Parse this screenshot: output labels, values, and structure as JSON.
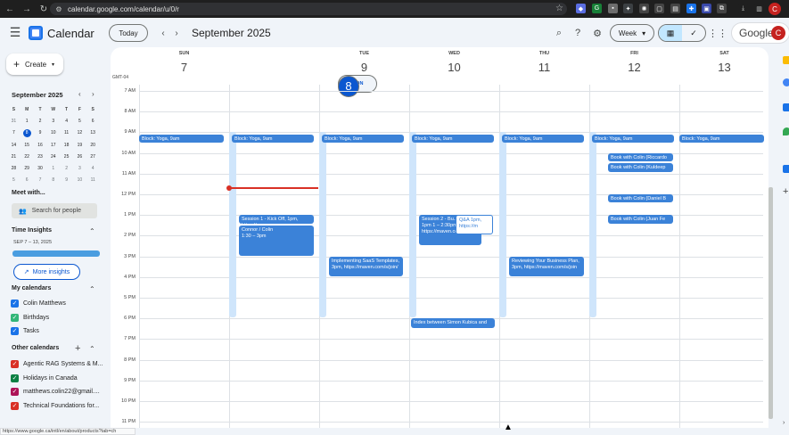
{
  "browser": {
    "url": "calendar.google.com/calendar/u/0/r",
    "profile_initial": "C",
    "status_url": "https://www.google.ca/intl/en/about/products?tab=ch"
  },
  "header": {
    "app_title": "Calendar",
    "today_label": "Today",
    "month_label": "September 2025",
    "view_label": "Week",
    "brand": "Google",
    "avatar_initial": "C"
  },
  "sidebar": {
    "create_label": "Create",
    "mini_month": "September 2025",
    "dows": [
      "S",
      "M",
      "T",
      "W",
      "T",
      "F",
      "S"
    ],
    "weeks": [
      [
        "31",
        "1",
        "2",
        "3",
        "4",
        "5",
        "6"
      ],
      [
        "7",
        "8",
        "9",
        "10",
        "11",
        "12",
        "13"
      ],
      [
        "14",
        "15",
        "16",
        "17",
        "18",
        "19",
        "20"
      ],
      [
        "21",
        "22",
        "23",
        "24",
        "25",
        "26",
        "27"
      ],
      [
        "28",
        "29",
        "30",
        "1",
        "2",
        "3",
        "4"
      ],
      [
        "5",
        "6",
        "7",
        "8",
        "9",
        "10",
        "11"
      ]
    ],
    "meet_title": "Meet with...",
    "search_people": "Search for people",
    "time_insights": "Time Insights",
    "time_insights_range": "SEP 7 – 13, 2025",
    "more_insights": "More insights",
    "my_calendars_title": "My calendars",
    "my_calendars": [
      {
        "name": "Colin Matthews",
        "color": "#1a73e8"
      },
      {
        "name": "Birthdays",
        "color": "#33b679"
      },
      {
        "name": "Tasks",
        "color": "#1a73e8"
      }
    ],
    "other_calendars_title": "Other calendars",
    "other_calendars": [
      {
        "name": "Agentic RAG Systems & M...",
        "color": "#d93025"
      },
      {
        "name": "Holidays in Canada",
        "color": "#0b8043"
      },
      {
        "name": "matthews.colin22@gmail....",
        "color": "#ad1457"
      },
      {
        "name": "Technical Foundations for...",
        "color": "#d93025"
      }
    ]
  },
  "week": {
    "timezone": "GMT-04",
    "days": [
      {
        "dow": "SUN",
        "num": "7"
      },
      {
        "dow": "MON",
        "num": "8"
      },
      {
        "dow": "TUE",
        "num": "9"
      },
      {
        "dow": "WED",
        "num": "10"
      },
      {
        "dow": "THU",
        "num": "11"
      },
      {
        "dow": "FRI",
        "num": "12"
      },
      {
        "dow": "SAT",
        "num": "13"
      }
    ],
    "hours": [
      "7 AM",
      "8 AM",
      "9 AM",
      "10 AM",
      "11 AM",
      "12 PM",
      "1 PM",
      "2 PM",
      "3 PM",
      "4 PM",
      "5 PM",
      "6 PM",
      "7 PM",
      "8 PM",
      "9 PM",
      "10 PM",
      "11 PM"
    ]
  },
  "events": {
    "yoga": "Block: Yoga, 9am",
    "session1": "Session 1 - Kick Off, 1pm, https://",
    "connor_title": "Connor / Colin",
    "connor_time": "1:30 – 3pm",
    "saas": "Implementing SaaS Templates, 3pm, https://maven.com/s/join/",
    "session2": "Session 2 - Bu... with AI - 1pm 1 – 2:30pm https://maven.com/s/join/",
    "qa": "Q&A 1pm, https://m",
    "index": "Index between Simon Kubica and",
    "review": "Reviewing Your Business Plan, 3pm, https://maven.com/s/join",
    "book1": "Book with Colin (Riccardo",
    "book2": "Book with Colin (Kuldeep",
    "book3": "Book with Colin (Daniel B",
    "book4": "Book with Colin (Juan Fe"
  }
}
